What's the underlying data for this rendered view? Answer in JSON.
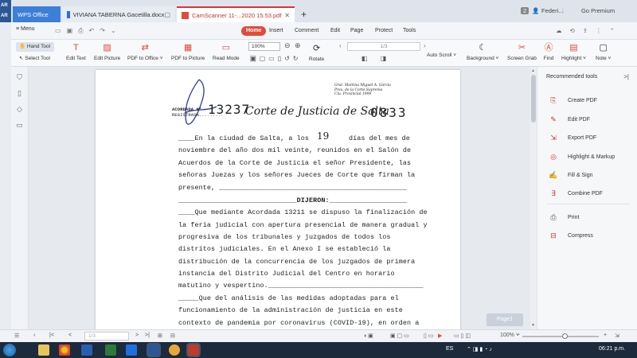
{
  "tabs": {
    "side_top": "AR",
    "side_bottom": "AR",
    "wps": "WPS Office",
    "doc": "VIVIANA TABERNA Gacetilla.docx",
    "pdf": "CamScanner 11-...2020 15.53.pdf",
    "plus": "+"
  },
  "titlebar": {
    "badge": "2",
    "user": "Federi...",
    "premium": "Go Premium"
  },
  "menu": {
    "label": "Menu",
    "tabs": [
      "Home",
      "Insert",
      "Comment",
      "Edit",
      "Page",
      "Protect",
      "Tools"
    ]
  },
  "ribbon": {
    "hand_tool": "Hand Tool",
    "select_tool": "Select Tool",
    "edit_text": "Edit Text",
    "edit_picture": "Edit Picture",
    "pdf_to_office": "PDF to Office",
    "pdf_to_picture": "PDF to Picture",
    "read_mode": "Read Mode",
    "zoom": "100%",
    "rotate": "Rotate",
    "page": "1/3",
    "auto_scroll": "Auto Scroll",
    "background": "Background",
    "screen_grab": "Screen Grab",
    "find": "Find",
    "highlight": "Highlight",
    "note": "Note"
  },
  "document": {
    "stamp_top": "Gral. Martina Miguel A. Garcia\nPres. de la Corte Suprema\nCiu. Provincial 1999",
    "acordada_label": "ACORDADA N°",
    "registrada_label": "REGISTRADA.........",
    "acordada_number": "13237",
    "court_title": "Corte de Justicia de Salta",
    "folio": "0833",
    "lines": [
      "____En la ciudad de Salta, a los",
      "noviembre del año dos mil veinte, reunidos en el Salón de",
      "Acuerdos de la Corte de Justicia el señor Presidente, las",
      "señoras Juezas y los señores Jueces de Corte que firman la",
      "presente, ______________________________________________",
      "_____________________________DIJERON:___________________",
      "____Que mediante Acordada 13211 se dispuso la finalización de",
      "la feria judicial con apertura presencial de manera gradual y",
      "progresiva de los tribunales y juzgados de todos los",
      "distritos judiciales. En el Anexo I se estableció la",
      "distribución de la concurrencia de los juzgados de primera",
      "instancia del Distrito Judicial del Centro en horario",
      "matutino y vespertino.______________________________________",
      "_____Que del análisis de las medidas adoptadas para el",
      "funcionamiento de la administración de justicia en este",
      "contexto de pandemia por coronavirus (COVID-19), en orden a"
    ],
    "handwritten_day": "19",
    "line1_tail": "días del mes de"
  },
  "right_panel": {
    "title": "Recommended tools",
    "items": [
      "Create PDF",
      "Edit PDF",
      "Export PDF",
      "Highlight & Markup",
      "Fill & Sign",
      "Combine PDF",
      "Print",
      "Compress"
    ]
  },
  "page_badge": "Page1",
  "statusbar": {
    "page": "1/3",
    "zoom": "100%"
  },
  "taskbar": {
    "lang": "ES",
    "time": "06:21 p.m."
  },
  "colors": {
    "accent": "#e24a3b",
    "wps_blue": "#3c7fd6",
    "taskbar": "#1c2a3c"
  }
}
